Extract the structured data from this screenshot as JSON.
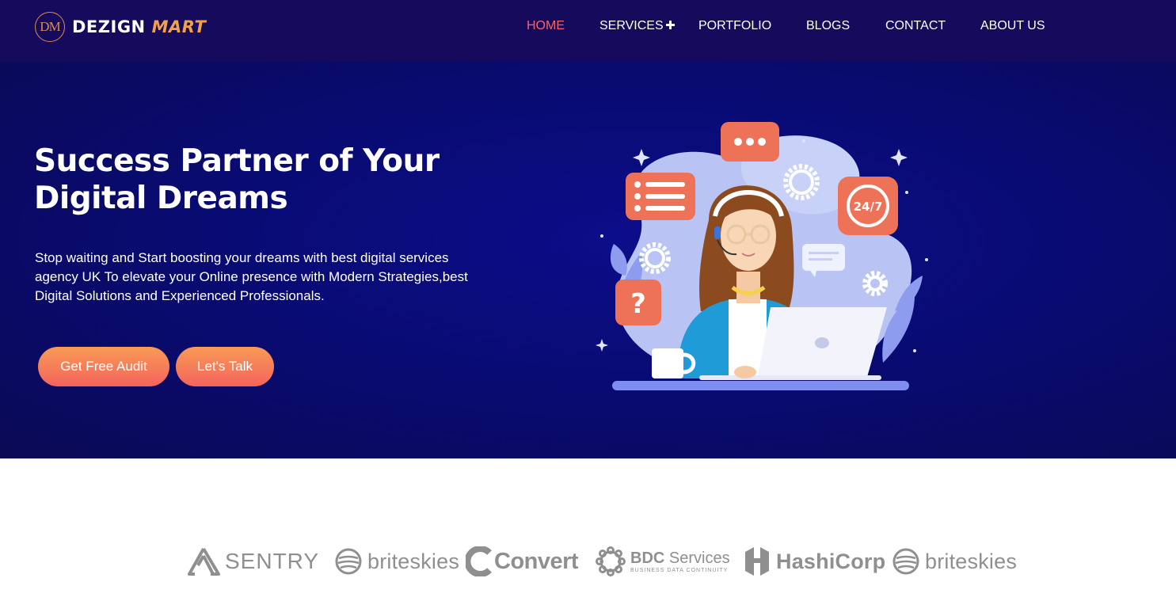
{
  "brand": {
    "mark": "DM",
    "word1": "DEZIGN",
    "word2": "MART",
    "accent_color": "#f2a049"
  },
  "nav": {
    "items": [
      {
        "label": "HOME",
        "active": true
      },
      {
        "label": "SERVICES",
        "icon": "plus-icon"
      },
      {
        "label": "PORTFOLIO"
      },
      {
        "label": "BLOGS"
      },
      {
        "label": "CONTACT"
      },
      {
        "label": "ABOUT US"
      }
    ],
    "active_color": "#f4646c"
  },
  "hero": {
    "title": "Success Partner of Your Digital Dreams",
    "description": "Stop waiting and Start boosting your dreams with best digital services agency UK To elevate your Online presence with Modern Strategies,best Digital Solutions and Experienced Professionals.",
    "buttons": {
      "audit": "Get Free Audit",
      "talk": "Let's Talk"
    },
    "illustration": {
      "badge_24_7": "24/7",
      "question_mark": "?"
    },
    "background_color": "#0a0c7a",
    "button_gradient": [
      "#f89a55",
      "#f4645d"
    ]
  },
  "clients": {
    "logos": [
      {
        "name": "SENTRY",
        "icon": "sentry-logo-icon"
      },
      {
        "name": "briteskies",
        "icon": "briteskies-logo-icon"
      },
      {
        "name": "Convert",
        "icon": "convert-logo-icon"
      },
      {
        "name": "BDC",
        "name_suffix": "Services",
        "tagline": "BUSINESS DATA CONTINUITY",
        "icon": "bdc-logo-icon"
      },
      {
        "name": "HashiCorp",
        "icon": "hashicorp-logo-icon"
      },
      {
        "name": "briteskies",
        "icon": "briteskies-logo-icon"
      }
    ]
  }
}
